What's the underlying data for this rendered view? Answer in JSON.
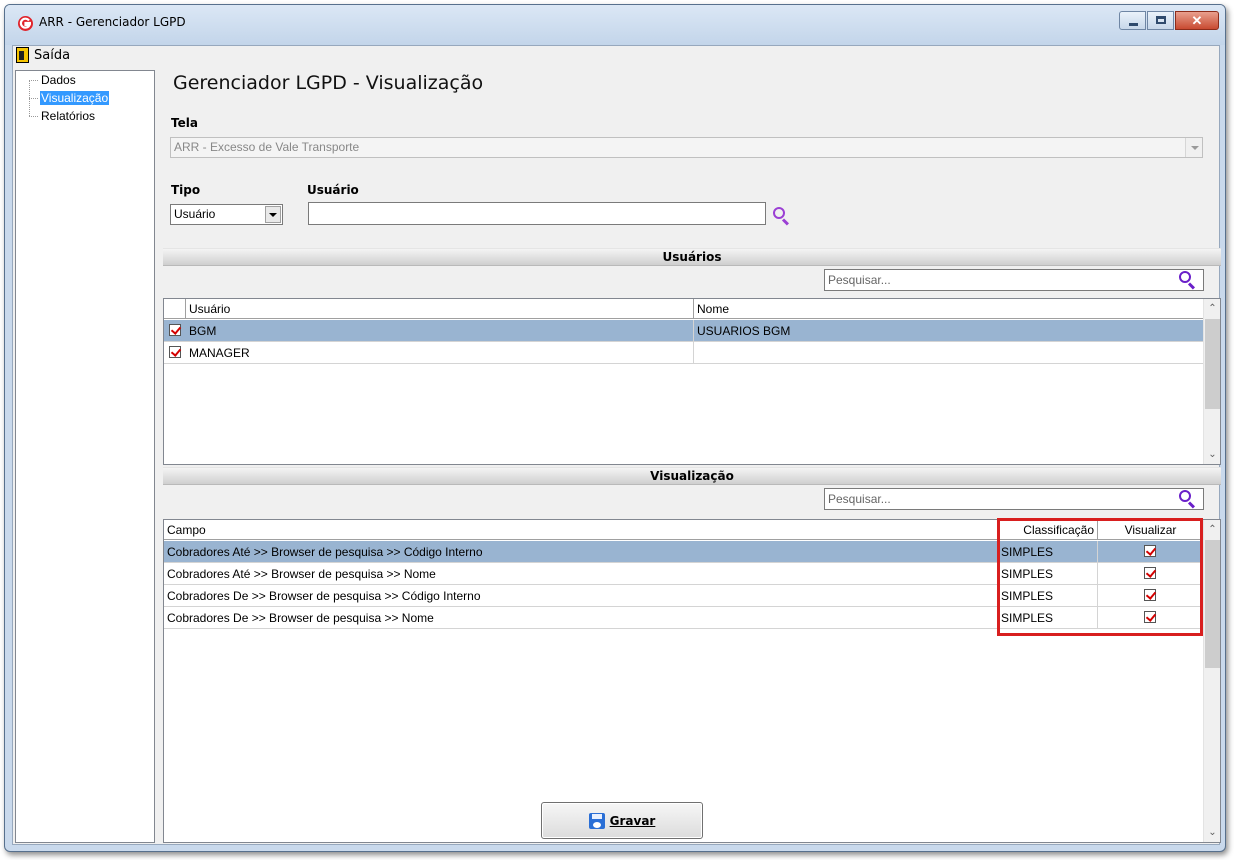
{
  "window": {
    "title": "ARR - Gerenciador LGPD",
    "close_glyph": "✕"
  },
  "menu": {
    "exit_label": "Saída"
  },
  "tree": {
    "items": [
      {
        "label": "Dados",
        "selected": false
      },
      {
        "label": "Visualização",
        "selected": true
      },
      {
        "label": "Relatórios",
        "selected": false
      }
    ]
  },
  "page": {
    "title": "Gerenciador LGPD - Visualização"
  },
  "form": {
    "tela_label": "Tela",
    "tela_value": "ARR - Excesso de Vale Transporte",
    "tipo_label": "Tipo",
    "tipo_value": "Usuário",
    "usuario_label": "Usuário",
    "usuario_value": ""
  },
  "usuarios_section": {
    "title": "Usuários",
    "search_placeholder": "Pesquisar...",
    "columns": [
      "Usuário",
      "Nome"
    ],
    "rows": [
      {
        "checked": true,
        "usuario": "BGM",
        "nome": "USUARIOS BGM",
        "selected": true
      },
      {
        "checked": true,
        "usuario": "MANAGER",
        "nome": "",
        "selected": false
      }
    ]
  },
  "visualizacao_section": {
    "title": "Visualização",
    "search_placeholder": "Pesquisar...",
    "columns": [
      "Campo",
      "Classificação",
      "Visualizar"
    ],
    "rows": [
      {
        "campo": "Cobradores Até >> Browser de pesquisa >> Código Interno",
        "classificacao": "SIMPLES",
        "visualizar": true,
        "selected": true
      },
      {
        "campo": "Cobradores Até >> Browser de pesquisa >> Nome",
        "classificacao": "SIMPLES",
        "visualizar": true,
        "selected": false
      },
      {
        "campo": "Cobradores De >> Browser de pesquisa >> Código Interno",
        "classificacao": "SIMPLES",
        "visualizar": true,
        "selected": false
      },
      {
        "campo": "Cobradores De >> Browser de pesquisa >> Nome",
        "classificacao": "SIMPLES",
        "visualizar": true,
        "selected": false
      }
    ]
  },
  "actions": {
    "save_label": "Gravar"
  },
  "colors": {
    "selection_row": "#99b4d1",
    "tree_selection": "#3399ff",
    "search_icon": "#9b3fd4",
    "highlight": "#d81f1f",
    "check": "#d40000"
  }
}
